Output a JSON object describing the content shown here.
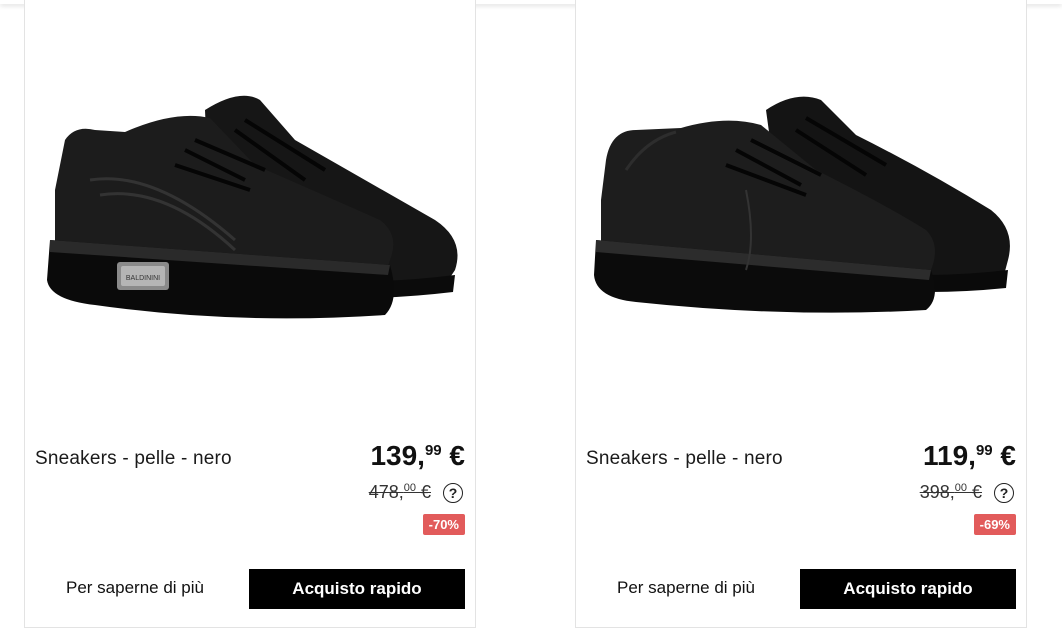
{
  "products": [
    {
      "title": "Sneakers - pelle - nero",
      "price_int": "139,",
      "price_cents": "99",
      "price_currency": " €",
      "old_price_int": "478,",
      "old_price_cents": "00",
      "old_price_currency": " €",
      "help": "?",
      "discount": "-70%",
      "more_label": "Per saperne di più",
      "buy_label": "Acquisto rapido",
      "image": "black-leather-sneakers-with-logo-plate",
      "brand_plate": "BALDININI"
    },
    {
      "title": "Sneakers - pelle - nero",
      "price_int": "119,",
      "price_cents": "99",
      "price_currency": " €",
      "old_price_int": "398,",
      "old_price_cents": "00",
      "old_price_currency": " €",
      "help": "?",
      "discount": "-69%",
      "more_label": "Per saperne di più",
      "buy_label": "Acquisto rapido",
      "image": "black-leather-low-sneakers"
    }
  ],
  "colors": {
    "discount_badge": "#e25b5b",
    "button_bg": "#000000",
    "button_text": "#ffffff"
  }
}
